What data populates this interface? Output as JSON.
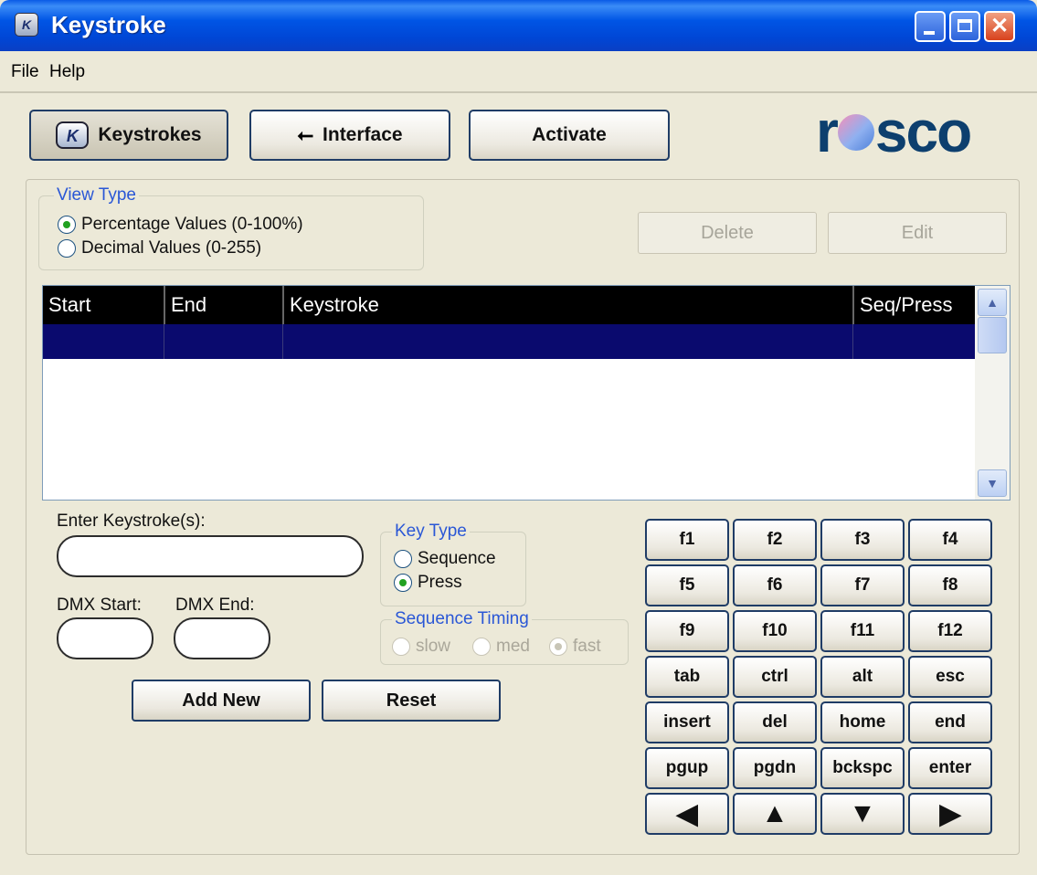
{
  "window": {
    "title": "Keystroke",
    "app_icon": "K"
  },
  "menu": {
    "file": "File",
    "help": "Help"
  },
  "nav": {
    "keystrokes": "Keystrokes",
    "interface": "Interface",
    "activate": "Activate",
    "keystrokes_icon": "K",
    "interface_icon": "usb-icon"
  },
  "logo": {
    "text_left": "r",
    "text_right": "sco"
  },
  "view_type": {
    "title": "View Type",
    "options": [
      {
        "label": "Percentage Values (0-100%)",
        "selected": true
      },
      {
        "label": "Decimal Values (0-255)",
        "selected": false
      }
    ]
  },
  "actions": {
    "delete": "Delete",
    "edit": "Edit"
  },
  "table": {
    "columns": [
      "Start",
      "End",
      "Keystroke",
      "Seq/Press"
    ],
    "rows": []
  },
  "form": {
    "enter_label": "Enter Keystroke(s):",
    "keystroke_value": "",
    "dmx_start_label": "DMX Start:",
    "dmx_end_label": "DMX End:",
    "dmx_start_value": "",
    "dmx_end_value": "",
    "add_new": "Add New",
    "reset": "Reset"
  },
  "key_type": {
    "title": "Key Type",
    "options": [
      {
        "label": "Sequence",
        "selected": false
      },
      {
        "label": "Press",
        "selected": true
      }
    ]
  },
  "sequence_timing": {
    "title": "Sequence Timing",
    "options": [
      {
        "label": "slow",
        "selected": false
      },
      {
        "label": "med",
        "selected": false
      },
      {
        "label": "fast",
        "selected": true
      }
    ]
  },
  "keys": [
    [
      "f1",
      "f2",
      "f3",
      "f4"
    ],
    [
      "f5",
      "f6",
      "f7",
      "f8"
    ],
    [
      "f9",
      "f10",
      "f11",
      "f12"
    ],
    [
      "tab",
      "ctrl",
      "alt",
      "esc"
    ],
    [
      "insert",
      "del",
      "home",
      "end"
    ],
    [
      "pgup",
      "pgdn",
      "bckspc",
      "enter"
    ],
    [
      "◀",
      "▲",
      "▼",
      "▶"
    ]
  ],
  "colors": {
    "title_bar": "#0055E5",
    "legend": "#2a57d6",
    "selected_row": "#0a0a6e",
    "radio_dot": "#21a121"
  }
}
